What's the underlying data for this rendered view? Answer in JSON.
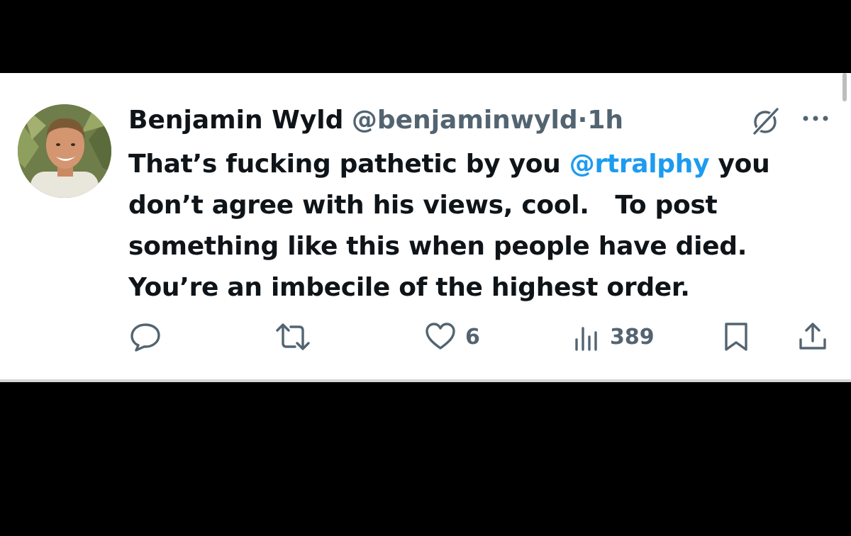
{
  "tweet": {
    "author_name": "Benjamin Wyld",
    "handle": "@benjaminwyld",
    "separator": "·",
    "time": "1h",
    "lines": [
      {
        "before": "That’s fucking pathetic by you ",
        "mention": "@rtralphy",
        "after": " you"
      },
      {
        "text": "don’t agree with his views, cool.   To post"
      },
      {
        "text": "something like this when people have died."
      },
      {
        "text": "You’re an imbecile of the highest order."
      }
    ]
  },
  "actions": {
    "reply": {
      "icon": "reply-icon"
    },
    "retweet": {
      "icon": "retweet-icon"
    },
    "like": {
      "icon": "heart-icon",
      "count": "6"
    },
    "views": {
      "icon": "views-icon",
      "count": "389"
    },
    "bookmark": {
      "icon": "bookmark-icon"
    },
    "share": {
      "icon": "share-icon"
    }
  },
  "colors": {
    "text": "#0f1419",
    "secondary": "#536471",
    "link": "#1d9bf0",
    "background": "#ffffff",
    "frame": "#000000"
  }
}
